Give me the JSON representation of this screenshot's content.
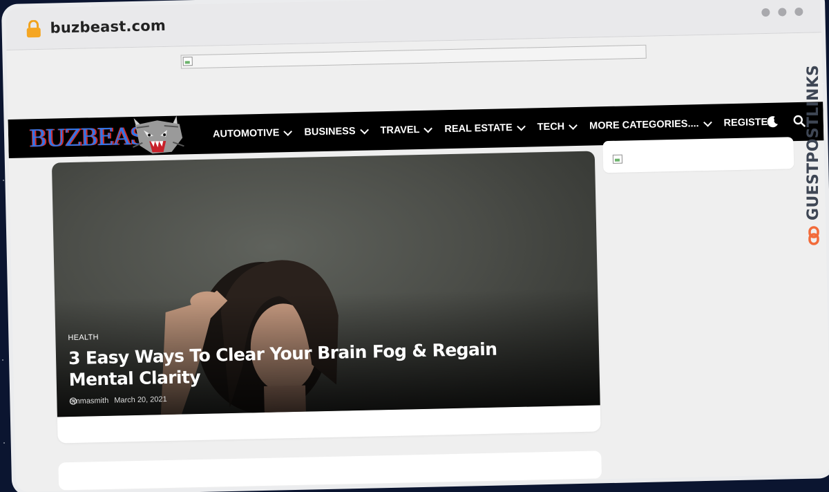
{
  "browser": {
    "url": "buzbeast.com"
  },
  "site": {
    "logo_text": "BUZBEAST"
  },
  "nav": {
    "items": [
      {
        "label": "AUTOMOTIVE",
        "has_dropdown": true
      },
      {
        "label": "BUSINESS",
        "has_dropdown": true
      },
      {
        "label": "TRAVEL",
        "has_dropdown": true
      },
      {
        "label": "REAL ESTATE",
        "has_dropdown": true
      },
      {
        "label": "TECH",
        "has_dropdown": true
      },
      {
        "label": "MORE CATEGORIES....",
        "has_dropdown": true
      },
      {
        "label": "REGISTER",
        "has_dropdown": false
      }
    ],
    "icons": [
      "moon-icon",
      "search-icon"
    ]
  },
  "featured": {
    "category": "HEALTH",
    "title": "3 Easy Ways To Clear Your Brain Fog & Regain Mental Clarity",
    "author": "emmasmith",
    "date": "March 20, 2021"
  },
  "watermark": {
    "text": "GUESTPOSTLINKS"
  },
  "colors": {
    "navbar_bg": "#000000",
    "page_bg": "#efefef",
    "logo_blue": "#2f76e8",
    "logo_red": "#d42d2d",
    "watermark_accent": "#f26b3a",
    "watermark_text": "#3e4654"
  }
}
